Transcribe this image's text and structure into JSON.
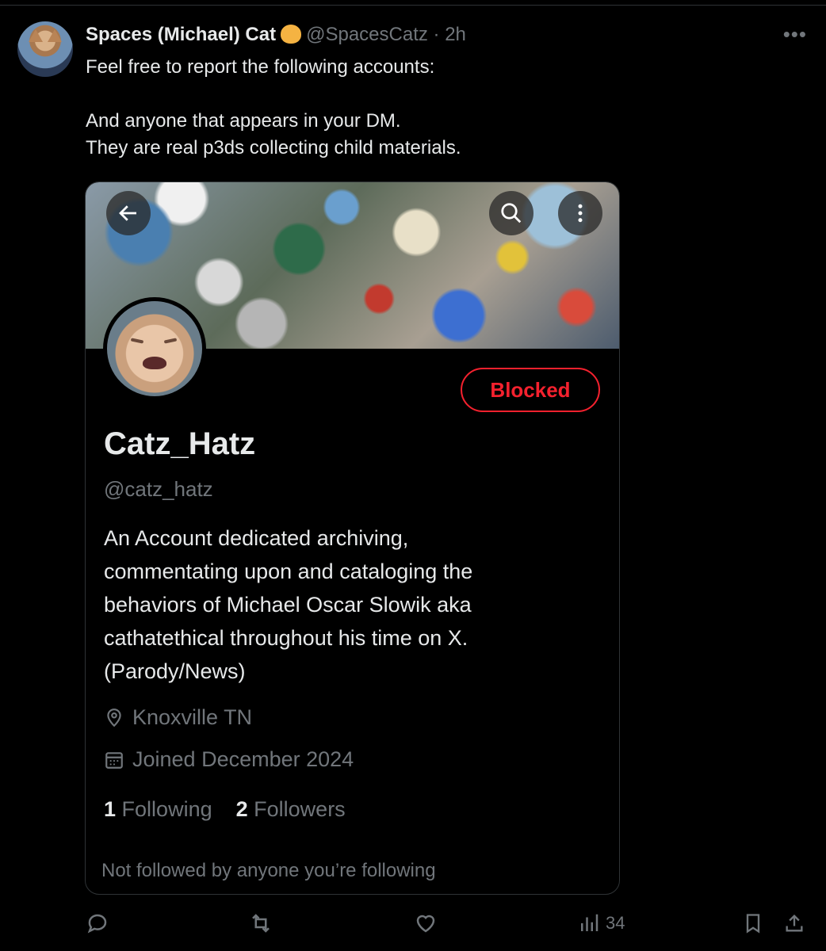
{
  "tweet": {
    "author_name": "Spaces (Michael) Cat",
    "author_handle": "@SpacesCatz",
    "time": "· 2h",
    "lines": [
      "Feel free to report the following accounts:",
      "And anyone that appears in your DM.",
      "They are real p3ds collecting child materials."
    ]
  },
  "profile_card": {
    "blocked_label": "Blocked",
    "display_name": "Catz_Hatz",
    "username": "@catz_hatz",
    "bio_lines": [
      "An Account dedicated archiving,",
      "commentating upon and cataloging the",
      "behaviors of Michael Oscar Slowik aka",
      "cathatethical throughout his time on X.",
      "(Parody/News)"
    ],
    "location": "Knoxville TN",
    "joined": "Joined December 2024",
    "following_count": "1",
    "following_label": "Following",
    "followers_count": "2",
    "followers_label": "Followers",
    "not_followed": "Not followed by anyone you’re following"
  },
  "actions": {
    "views": "34"
  },
  "colors": {
    "background": "#000000",
    "text": "#e7e9ea",
    "muted": "#71767b",
    "blocked_red": "#f4212e",
    "border": "#2f3336"
  },
  "icons": [
    "back-arrow-icon",
    "search-icon",
    "more-vertical-icon",
    "more-horizontal-icon",
    "location-icon",
    "calendar-icon",
    "reply-icon",
    "retweet-icon",
    "like-icon",
    "views-icon",
    "bookmark-icon",
    "share-icon"
  ]
}
